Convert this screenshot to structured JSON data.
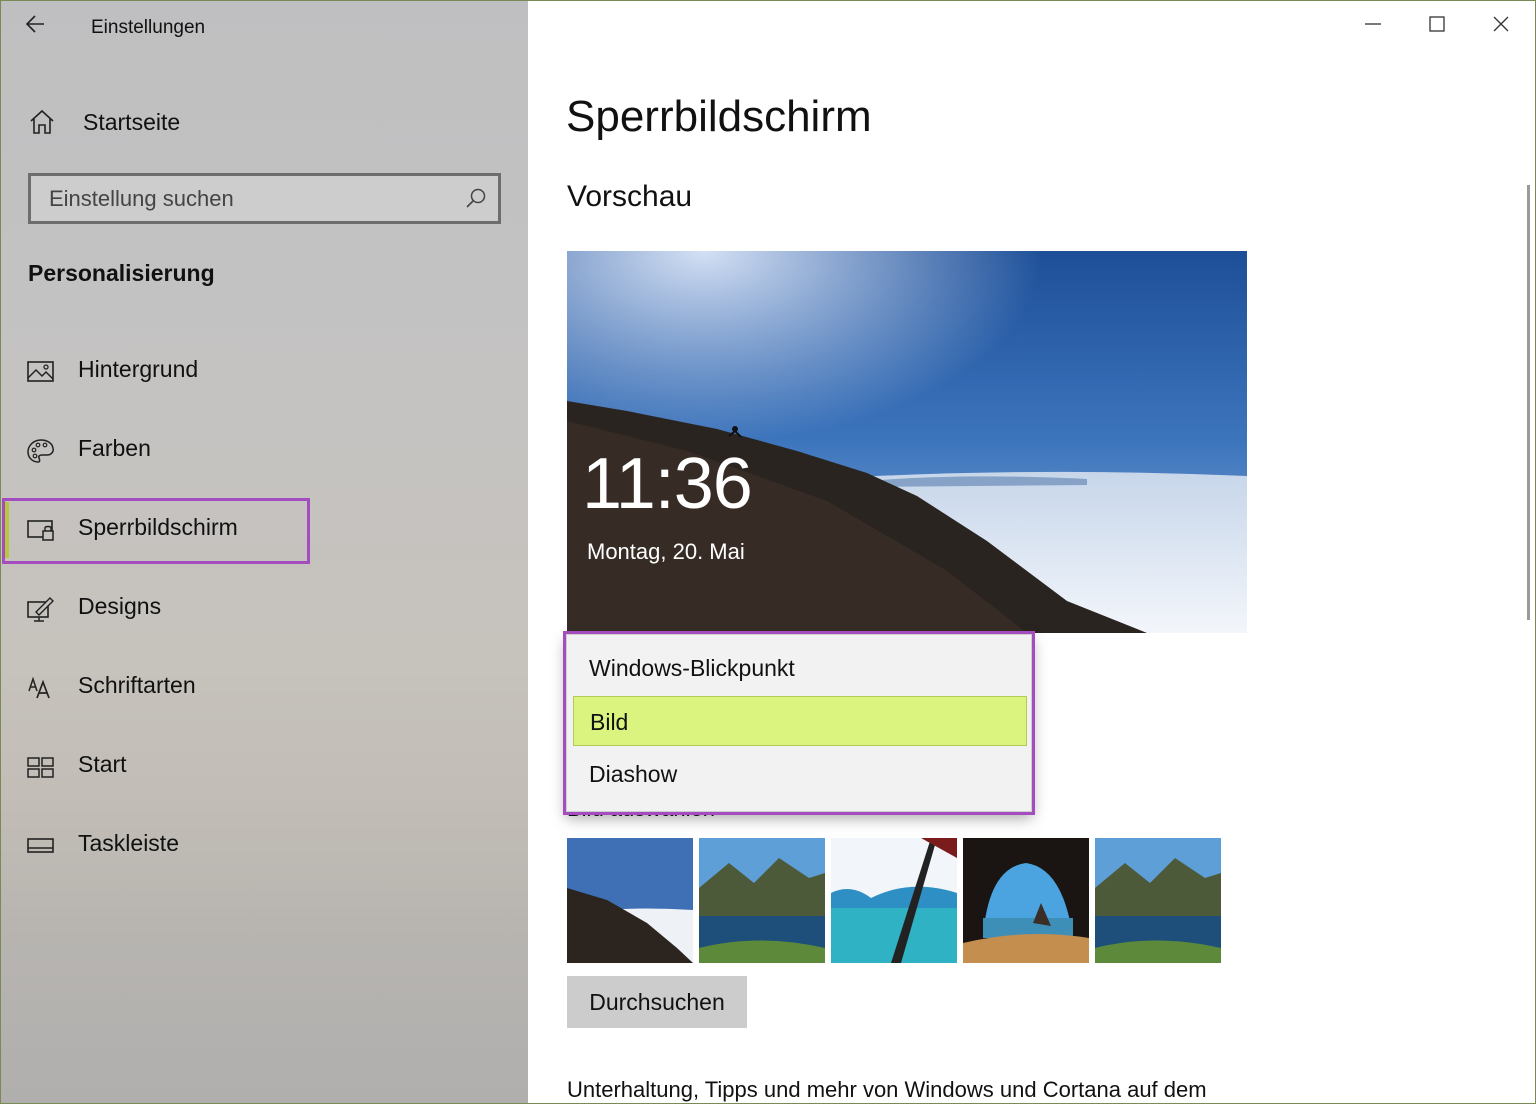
{
  "app": {
    "title": "Einstellungen"
  },
  "sidebar": {
    "home_label": "Startseite",
    "search_placeholder": "Einstellung suchen",
    "section_title": "Personalisierung",
    "items": [
      {
        "label": "Hintergrund",
        "icon": "picture-icon"
      },
      {
        "label": "Farben",
        "icon": "palette-icon"
      },
      {
        "label": "Sperrbildschirm",
        "icon": "lock-screen-icon",
        "active": true
      },
      {
        "label": "Designs",
        "icon": "themes-icon"
      },
      {
        "label": "Schriftarten",
        "icon": "fonts-icon"
      },
      {
        "label": "Start",
        "icon": "start-icon"
      },
      {
        "label": "Taskleiste",
        "icon": "taskbar-icon"
      }
    ]
  },
  "content": {
    "page_title": "Sperrbildschirm",
    "preview_heading": "Vorschau",
    "preview_time": "11:36",
    "preview_date": "Montag, 20. Mai",
    "background_dropdown": {
      "options": [
        "Windows-Blickpunkt",
        "Bild",
        "Diashow"
      ],
      "selected": "Bild"
    },
    "choose_picture_label": "Bild auswählen",
    "browse_button": "Durchsuchen",
    "footer_text": "Unterhaltung, Tipps und mehr von Windows und Cortana auf dem"
  },
  "colors": {
    "accent": "#b6c73a",
    "selection_highlight": "#daf47f",
    "annotation_outline": "#a44dbe"
  }
}
